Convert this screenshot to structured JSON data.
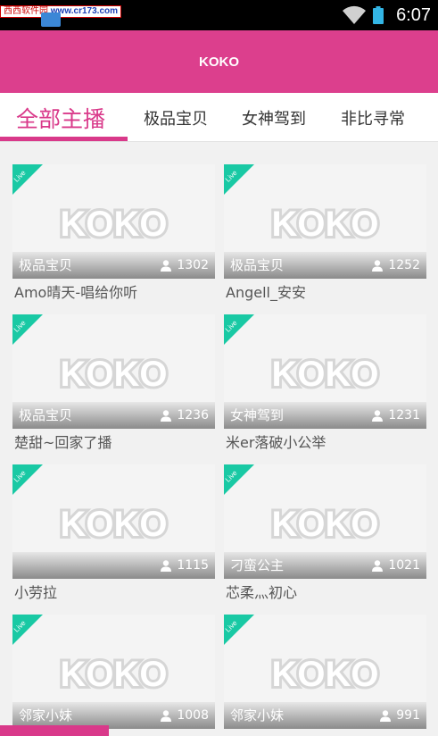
{
  "status_bar": {
    "watermark_site": "西西软件园",
    "watermark_url": "www.cr173.com",
    "time": "6:07"
  },
  "header": {
    "title": "KOKO"
  },
  "tabs": [
    {
      "label": "全部主播",
      "active": true
    },
    {
      "label": "极品宝贝",
      "active": false
    },
    {
      "label": "女神驾到",
      "active": false
    },
    {
      "label": "非比寻常",
      "active": false
    }
  ],
  "placeholder_logo": "KOKO",
  "live_badge": "Live",
  "colors": {
    "accent": "#dc3f8d",
    "live_badge": "#19c9a4"
  },
  "streams": [
    {
      "category": "极品宝贝",
      "viewers": "1302",
      "title": "Amo晴天-唱给你听"
    },
    {
      "category": "极品宝贝",
      "viewers": "1252",
      "title": "Angell_安安"
    },
    {
      "category": "极品宝贝",
      "viewers": "1236",
      "title": "楚甜~回家了播"
    },
    {
      "category": "女神驾到",
      "viewers": "1231",
      "title": "米er落破小公举"
    },
    {
      "category": "",
      "viewers": "1115",
      "title": "小劳拉"
    },
    {
      "category": "刁蛮公主",
      "viewers": "1021",
      "title": "芯柔灬初心"
    },
    {
      "category": "邻家小妹",
      "viewers": "1008",
      "title": ""
    },
    {
      "category": "邻家小妹",
      "viewers": "991",
      "title": ""
    }
  ]
}
